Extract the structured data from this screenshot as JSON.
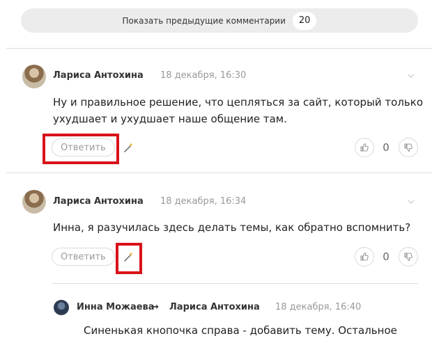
{
  "show_previous": {
    "label": "Показать предыдущие комментарии",
    "count": "20"
  },
  "comments": [
    {
      "author": "Лариса Антохина",
      "date": "18 декабря, 16:30",
      "text_line1": "Ну и правильное решение, что цепляться за сайт, который только",
      "text_line2": "ухудшает и ухудшает наше общение там.",
      "reply_label": "Ответить",
      "score": "0"
    },
    {
      "author": "Лариса Антохина",
      "date": "18 декабря, 16:34",
      "text_line1": "Инна, я разучилась здесь делать темы, как обратно вспомнить?",
      "reply_label": "Ответить",
      "score": "0"
    },
    {
      "author": "Инна Можаева",
      "arrow": "→",
      "recipient": "Лариса Антохина",
      "date": "18 декабря, 16:40",
      "text_line1": "Синенькая кнопочка справа - добавить тему. Остальное"
    }
  ],
  "highlight_color": "#d9121a"
}
